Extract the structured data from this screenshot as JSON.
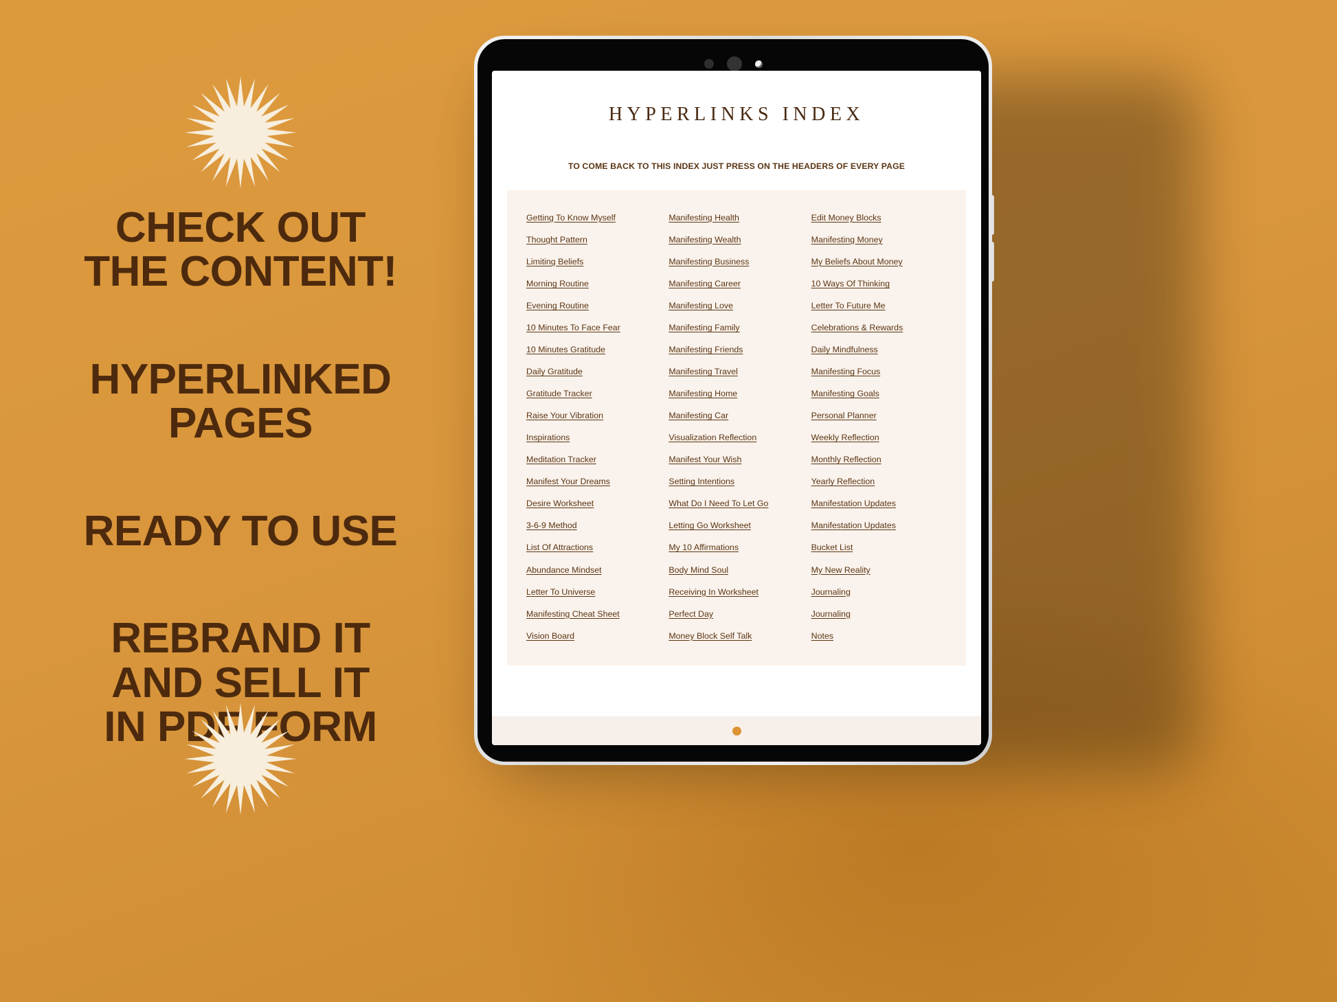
{
  "theme": {
    "background": "#d9963c",
    "text_dark": "#4d2a0d",
    "link_color": "#5a3512",
    "panel_bg": "#faf2ec",
    "page_bg": "#ffffff",
    "home_dot": "#dc9433",
    "sunburst": "#f7eedd"
  },
  "promo": {
    "blocks": [
      {
        "name": "check-out-content",
        "lines": [
          "CHECK OUT",
          "THE CONTENT!"
        ]
      },
      {
        "name": "hyperlinked-pages",
        "lines": [
          "HYPERLINKED",
          "PAGES"
        ]
      },
      {
        "name": "ready-to-use",
        "lines": [
          "READY TO USE"
        ]
      },
      {
        "name": "rebrand-sell",
        "lines": [
          "REBRAND IT",
          "AND SELL IT",
          "IN PDF FORM"
        ]
      }
    ],
    "decorations": [
      "sunburst-icon",
      "sunburst-icon"
    ]
  },
  "device": {
    "type": "tablet",
    "sensors": [
      "sensor-dot",
      "sensor-dot-large",
      "camera-lens"
    ],
    "side_buttons": [
      "volume-up-button",
      "volume-down-button"
    ],
    "home_indicator": "home-dot"
  },
  "document": {
    "title": "HYPERLINKS INDEX",
    "subtitle": "TO COME BACK TO THIS INDEX JUST PRESS ON THE HEADERS OF EVERY PAGE",
    "columns": [
      {
        "name": "column-1",
        "links": [
          "Getting To Know Myself",
          "Thought Pattern",
          "Limiting Beliefs",
          "Morning Routine",
          "Evening Routine",
          "10 Minutes To Face Fear",
          "10 Minutes Gratitude",
          "Daily Gratitude",
          "Gratitude Tracker",
          "Raise Your Vibration",
          "Inspirations",
          "Meditation Tracker",
          "Manifest Your Dreams",
          "Desire Worksheet",
          "3-6-9 Method",
          "List Of Attractions",
          "Abundance Mindset",
          "Letter To Universe",
          "Manifesting Cheat Sheet",
          "Vision Board"
        ]
      },
      {
        "name": "column-2",
        "links": [
          "Manifesting Health",
          "Manifesting Wealth",
          "Manifesting Business",
          "Manifesting Career",
          "Manifesting Love",
          "Manifesting Family",
          "Manifesting Friends",
          "Manifesting Travel",
          "Manifesting Home",
          "Manifesting Car",
          "Visualization Reflection",
          "Manifest Your Wish",
          "Setting Intentions",
          "What Do I Need To Let Go",
          "Letting Go Worksheet",
          "My 10 Affirmations",
          "Body Mind Soul",
          "Receiving In Worksheet",
          "Perfect Day",
          "Money Block Self Talk"
        ]
      },
      {
        "name": "column-3",
        "links": [
          "Edit Money Blocks",
          "Manifesting Money",
          "My Beliefs About Money",
          "10 Ways Of Thinking",
          "Letter To Future Me",
          "Celebrations & Rewards",
          "Daily Mindfulness",
          "Manifesting Focus",
          "Manifesting Goals",
          "Personal Planner",
          "Weekly Reflection",
          "Monthly Reflection",
          "Yearly Reflection",
          "Manifestation Updates",
          "Manifestation Updates",
          "Bucket List",
          "My New Reality",
          "Journaling",
          "Journaling",
          "Notes"
        ]
      }
    ]
  }
}
